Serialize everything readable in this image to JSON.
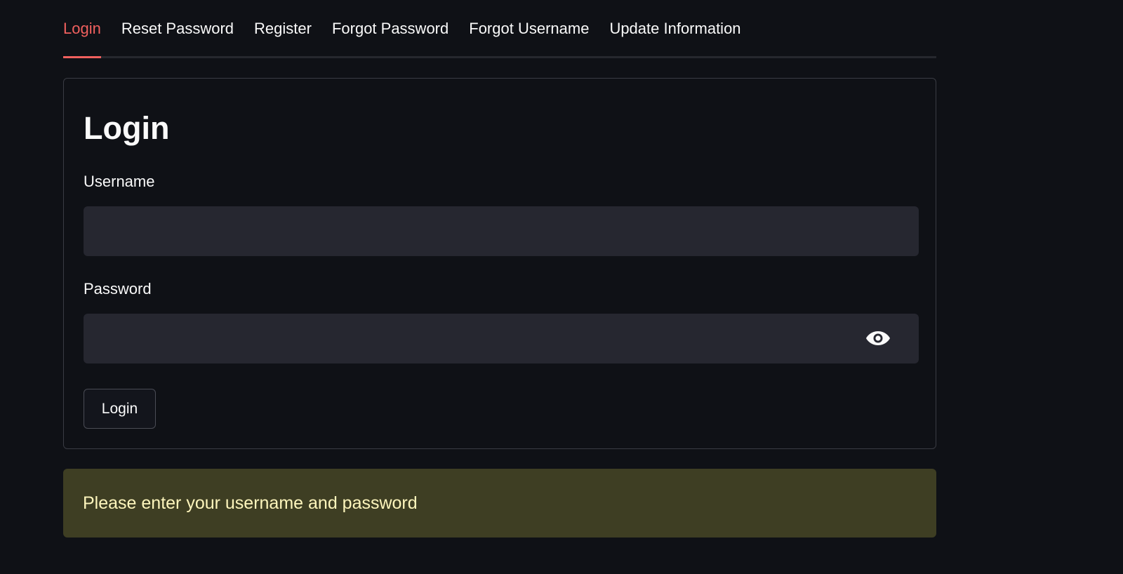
{
  "tabs": [
    {
      "label": "Login",
      "active": true
    },
    {
      "label": "Reset Password",
      "active": false
    },
    {
      "label": "Register",
      "active": false
    },
    {
      "label": "Forgot Password",
      "active": false
    },
    {
      "label": "Forgot Username",
      "active": false
    },
    {
      "label": "Update Information",
      "active": false
    }
  ],
  "form": {
    "title": "Login",
    "username_label": "Username",
    "username_value": "",
    "password_label": "Password",
    "password_value": "",
    "submit_label": "Login",
    "password_toggle_icon": "eye-icon"
  },
  "alert": {
    "message": "Please enter your username and password"
  },
  "colors": {
    "background": "#0f1116",
    "accent": "#f0605e",
    "input_bg": "#262730",
    "alert_bg": "#3e3e23",
    "alert_text": "#fdf5bc"
  }
}
